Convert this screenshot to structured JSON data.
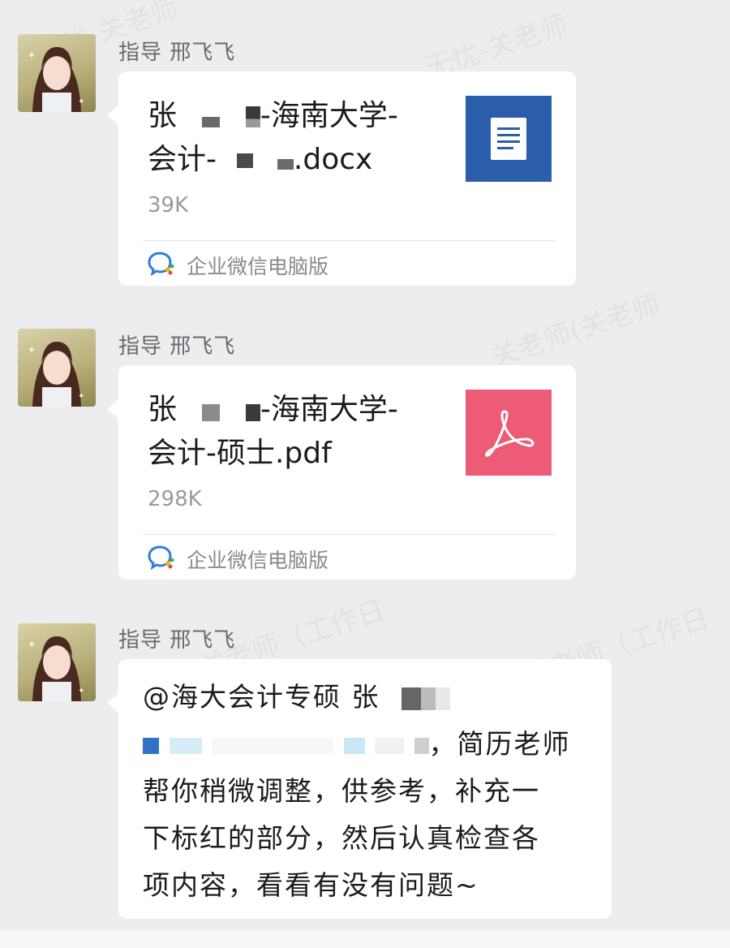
{
  "messages": [
    {
      "type": "file",
      "sender": "指导 邢飞飞",
      "file": {
        "name": "张 -海南大学-会计- .docx",
        "name_parts": [
          "张",
          "-海南大学-",
          "会计-",
          ".docx"
        ],
        "size": "39K",
        "icon": "word-doc-icon",
        "icon_color": "#2b5eaa"
      },
      "source_label": "企业微信电脑版",
      "source_icon": "wecom-icon"
    },
    {
      "type": "file",
      "sender": "指导 邢飞飞",
      "file": {
        "name": "张 -海南大学-会计-硕士.pdf",
        "name_parts": [
          "张",
          "-海南大学-",
          "会计-硕士.pdf"
        ],
        "size": "298K",
        "icon": "pdf-icon",
        "icon_color": "#ee5b76"
      },
      "source_label": "企业微信电脑版",
      "source_icon": "wecom-icon"
    },
    {
      "type": "text",
      "sender": "指导 邢飞飞",
      "text_parts": [
        "@海大会计专硕 张",
        "，简历老师",
        "帮你稍微调整，供参考，补充一",
        "下标红的部分，然后认真检查各",
        "项内容，看看有没有问题~"
      ]
    }
  ],
  "colors": {
    "background": "#ededf0",
    "bubble": "#ffffff",
    "sender_text": "#6a6a6e",
    "meta_text": "#9a9a9e"
  }
}
